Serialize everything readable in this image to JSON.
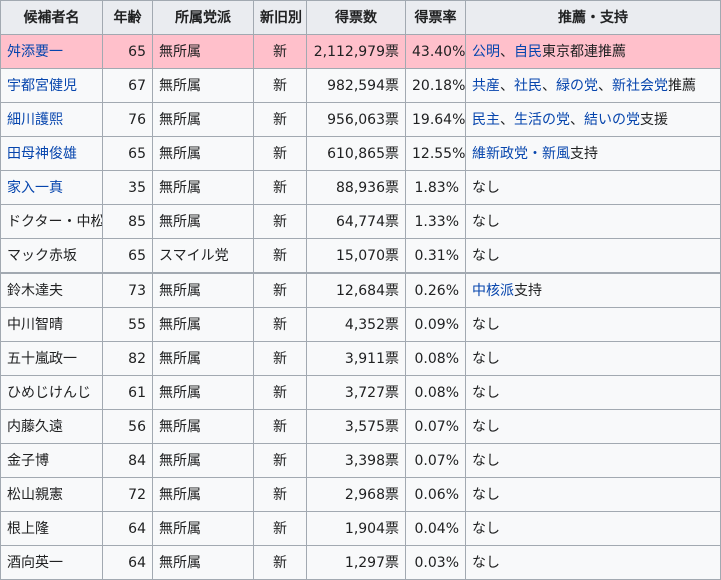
{
  "table": {
    "headers": [
      "候補者名",
      "年齢",
      "所属党派",
      "新旧別",
      "得票数",
      "得票率",
      "推薦・支持"
    ],
    "rows": [
      {
        "name": "舛添要一",
        "name_link": true,
        "age": "65",
        "party": "無所属",
        "status": "新",
        "votes": "2,112,979票",
        "pct": "43.40%",
        "support": [
          {
            "text": "公明",
            "link": true
          },
          {
            "text": "、",
            "link": false
          },
          {
            "text": "自民",
            "link": true
          },
          {
            "text": "東京都連推薦",
            "link": false
          }
        ],
        "winner": true
      },
      {
        "name": "宇都宮健児",
        "name_link": true,
        "age": "67",
        "party": "無所属",
        "status": "新",
        "votes": "982,594票",
        "pct": "20.18%",
        "support": [
          {
            "text": "共産",
            "link": true
          },
          {
            "text": "、",
            "link": false
          },
          {
            "text": "社民",
            "link": true
          },
          {
            "text": "、",
            "link": false
          },
          {
            "text": "緑の党",
            "link": true
          },
          {
            "text": "、",
            "link": false
          },
          {
            "text": "新社会党",
            "link": true
          },
          {
            "text": "推薦",
            "link": false
          }
        ]
      },
      {
        "name": "細川護熙",
        "name_link": true,
        "age": "76",
        "party": "無所属",
        "status": "新",
        "votes": "956,063票",
        "pct": "19.64%",
        "support": [
          {
            "text": "民主",
            "link": true
          },
          {
            "text": "、",
            "link": false
          },
          {
            "text": "生活の党",
            "link": true
          },
          {
            "text": "、",
            "link": false
          },
          {
            "text": "結いの党",
            "link": true
          },
          {
            "text": "支援",
            "link": false
          }
        ]
      },
      {
        "name": "田母神俊雄",
        "name_link": true,
        "age": "65",
        "party": "無所属",
        "status": "新",
        "votes": "610,865票",
        "pct": "12.55%",
        "support": [
          {
            "text": "維新政党・新風",
            "link": true
          },
          {
            "text": "支持",
            "link": false
          }
        ]
      },
      {
        "name": "家入一真",
        "name_link": true,
        "age": "35",
        "party": "無所属",
        "status": "新",
        "votes": "88,936票",
        "pct": "1.83%",
        "support": [
          {
            "text": "なし",
            "link": false
          }
        ]
      },
      {
        "name": "ドクター・中松",
        "name_link": false,
        "age": "85",
        "party": "無所属",
        "status": "新",
        "votes": "64,774票",
        "pct": "1.33%",
        "support": [
          {
            "text": "なし",
            "link": false
          }
        ]
      },
      {
        "name": "マック赤坂",
        "name_link": false,
        "age": "65",
        "party": "スマイル党",
        "status": "新",
        "votes": "15,070票",
        "pct": "0.31%",
        "support": [
          {
            "text": "なし",
            "link": false
          }
        ],
        "sep": true
      },
      {
        "name": "鈴木達夫",
        "name_link": false,
        "age": "73",
        "party": "無所属",
        "status": "新",
        "votes": "12,684票",
        "pct": "0.26%",
        "support": [
          {
            "text": "中核派",
            "link": true
          },
          {
            "text": "支持",
            "link": false
          }
        ]
      },
      {
        "name": "中川智晴",
        "name_link": false,
        "age": "55",
        "party": "無所属",
        "status": "新",
        "votes": "4,352票",
        "pct": "0.09%",
        "support": [
          {
            "text": "なし",
            "link": false
          }
        ]
      },
      {
        "name": "五十嵐政一",
        "name_link": false,
        "age": "82",
        "party": "無所属",
        "status": "新",
        "votes": "3,911票",
        "pct": "0.08%",
        "support": [
          {
            "text": "なし",
            "link": false
          }
        ]
      },
      {
        "name": "ひめじけんじ",
        "name_link": false,
        "age": "61",
        "party": "無所属",
        "status": "新",
        "votes": "3,727票",
        "pct": "0.08%",
        "support": [
          {
            "text": "なし",
            "link": false
          }
        ]
      },
      {
        "name": "内藤久遠",
        "name_link": false,
        "age": "56",
        "party": "無所属",
        "status": "新",
        "votes": "3,575票",
        "pct": "0.07%",
        "support": [
          {
            "text": "なし",
            "link": false
          }
        ]
      },
      {
        "name": "金子博",
        "name_link": false,
        "age": "84",
        "party": "無所属",
        "status": "新",
        "votes": "3,398票",
        "pct": "0.07%",
        "support": [
          {
            "text": "なし",
            "link": false
          }
        ]
      },
      {
        "name": "松山親憲",
        "name_link": false,
        "age": "72",
        "party": "無所属",
        "status": "新",
        "votes": "2,968票",
        "pct": "0.06%",
        "support": [
          {
            "text": "なし",
            "link": false
          }
        ]
      },
      {
        "name": "根上隆",
        "name_link": false,
        "age": "64",
        "party": "無所属",
        "status": "新",
        "votes": "1,904票",
        "pct": "0.04%",
        "support": [
          {
            "text": "なし",
            "link": false
          }
        ]
      },
      {
        "name": "酒向英一",
        "name_link": false,
        "age": "64",
        "party": "無所属",
        "status": "新",
        "votes": "1,297票",
        "pct": "0.03%",
        "support": [
          {
            "text": "なし",
            "link": false
          }
        ]
      }
    ]
  },
  "colors": {
    "header_bg": "#eaecf0",
    "cell_bg": "#f8f9fa",
    "winner_bg": "#ffc0cb",
    "link": "#0645ad",
    "border": "#a2a9b1"
  }
}
